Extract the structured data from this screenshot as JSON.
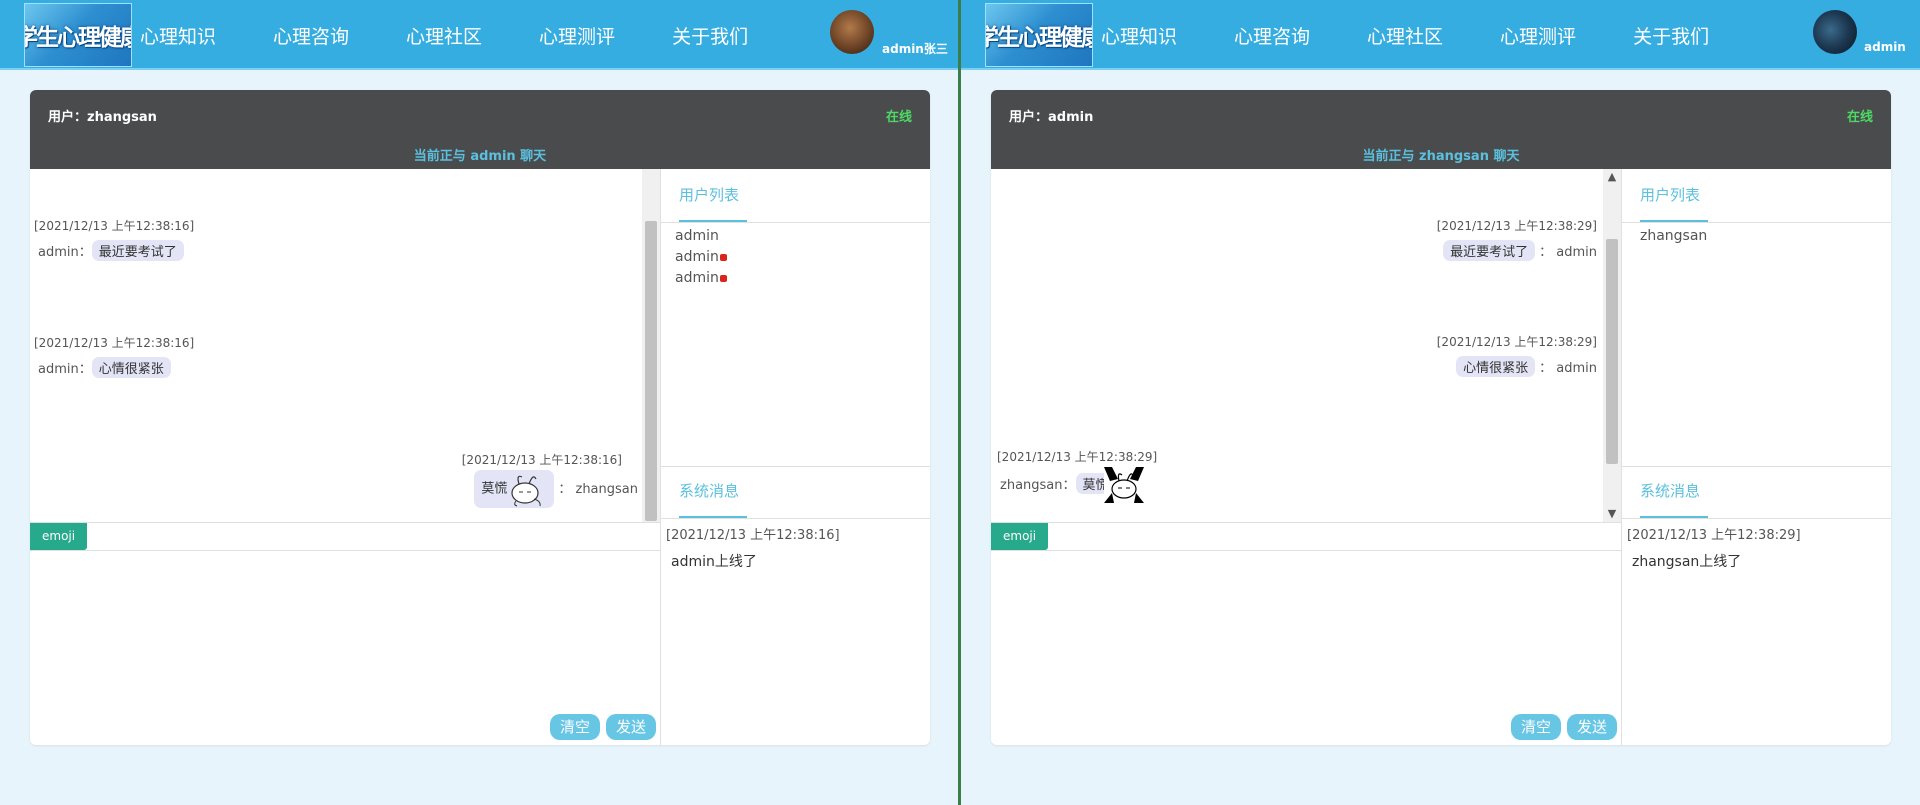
{
  "brand": {
    "logo_text": "学生心理健康"
  },
  "nav": [
    "心理知识",
    "心理咨询",
    "心理社区",
    "心理测评",
    "关于我们"
  ],
  "left": {
    "nav_user": "admin张三",
    "header": {
      "user_label": "用户：zhangsan",
      "status": "在线",
      "chatting_with": "当前正与  admin  聊天"
    },
    "messages": [
      {
        "time": "[2021/12/13 上午12:38:16]",
        "sender": "admin：",
        "text": "最近要考试了"
      },
      {
        "time": "[2021/12/13 上午12:38:16]",
        "sender": "admin：",
        "text": "心情很紧张"
      },
      {
        "time": "[2021/12/13 上午12:38:16]",
        "sender": "：  zhangsan",
        "text": "莫慌"
      }
    ],
    "user_list_title": "用户列表",
    "users": [
      "admin",
      "admin",
      "admin"
    ],
    "system_title": "系统消息",
    "system": {
      "time": "[2021/12/13 上午12:38:16]",
      "text": "admin上线了"
    },
    "emoji_label": "emoji",
    "clear_label": "清空",
    "send_label": "发送"
  },
  "right": {
    "nav_user": "admin",
    "header": {
      "user_label": "用户：admin",
      "status": "在线",
      "chatting_with": "当前正与  zhangsan  聊天"
    },
    "messages": [
      {
        "time": "[2021/12/13 上午12:38:29]",
        "sender": "：  admin",
        "text": "最近要考试了"
      },
      {
        "time": "[2021/12/13 上午12:38:29]",
        "sender": "：  admin",
        "text": "心情很紧张"
      },
      {
        "time": "[2021/12/13 上午12:38:29]",
        "sender": "zhangsan：",
        "text": "莫慌"
      }
    ],
    "user_list_title": "用户列表",
    "users": [
      "zhangsan"
    ],
    "system_title": "系统消息",
    "system": {
      "time": "[2021/12/13 上午12:38:29]",
      "text": "zhangsan上线了"
    },
    "emoji_label": "emoji",
    "clear_label": "清空",
    "send_label": "发送"
  },
  "colors": {
    "navbar": "#36ade0",
    "header": "#4a4b4d",
    "online": "#4cd964",
    "accent": "#5bc0de",
    "emoji_button": "#27a98c",
    "action_button": "#66c6e3",
    "bubble": "#e3e5f6",
    "unread_dot": "#d9251c"
  }
}
